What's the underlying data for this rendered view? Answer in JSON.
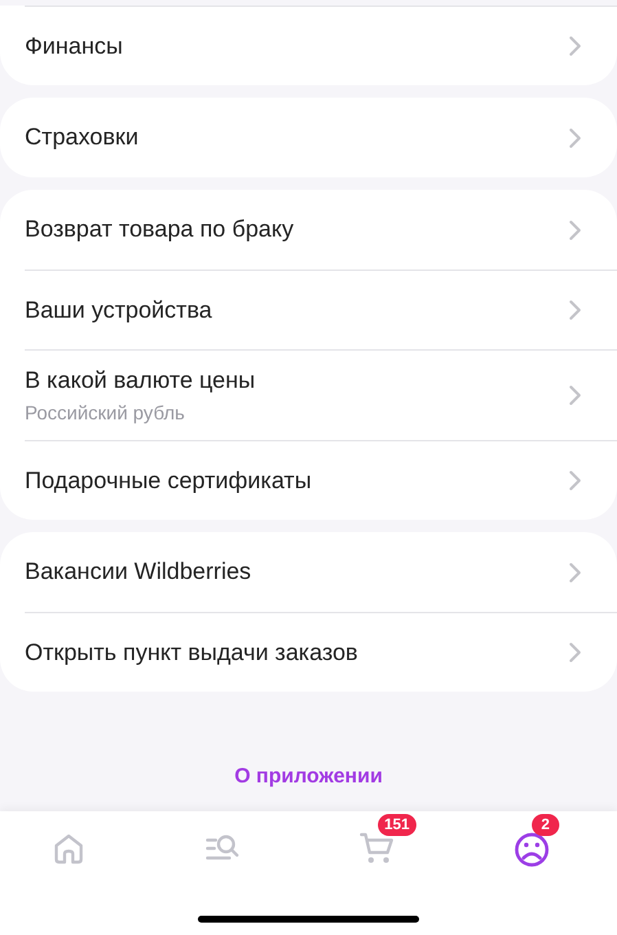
{
  "menu_groups": [
    {
      "items": [
        {
          "label": "Финансы"
        }
      ]
    },
    {
      "items": [
        {
          "label": "Страховки"
        }
      ]
    },
    {
      "items": [
        {
          "label": "Возврат товара по браку"
        },
        {
          "label": "Ваши устройства"
        },
        {
          "label": "В какой валюте цены",
          "subtitle": "Российский рубль"
        },
        {
          "label": "Подарочные сертификаты"
        }
      ]
    },
    {
      "items": [
        {
          "label": "Вакансии Wildberries"
        },
        {
          "label": "Открыть пункт выдачи заказов"
        }
      ]
    }
  ],
  "about_link": "О приложении",
  "tab_bar": [
    {
      "kind": "home",
      "selected": false
    },
    {
      "kind": "catalog",
      "selected": false
    },
    {
      "kind": "cart",
      "selected": false,
      "badge": "151"
    },
    {
      "kind": "profile",
      "selected": true,
      "badge": "2"
    }
  ]
}
